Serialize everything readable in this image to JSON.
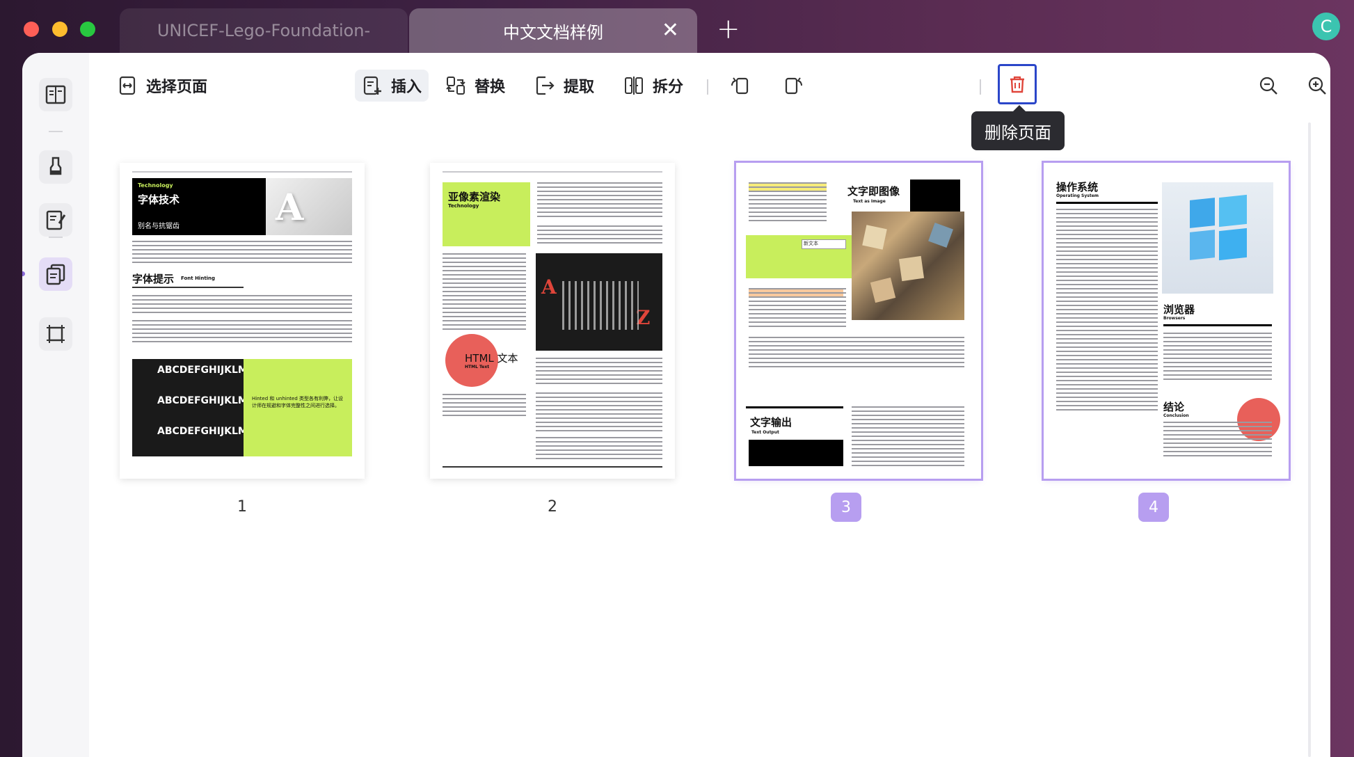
{
  "window": {
    "tabs": [
      {
        "label": "UNICEF-Lego-Foundation-",
        "active": false
      },
      {
        "label": "中文文档样例",
        "active": true
      }
    ],
    "tab_close": "✕",
    "new_tab": "+",
    "avatar_letter": "C"
  },
  "toolbar": {
    "select_pages": "选择页面",
    "insert": "插入",
    "replace": "替换",
    "extract": "提取",
    "split": "拆分",
    "delete_tooltip": "删除页面"
  },
  "pages": [
    {
      "number": "1",
      "title": "字体技术",
      "tag": "Technology",
      "subtitle": "别名与抗锯齿",
      "section": "字体提示",
      "section_en": "Font Hinting",
      "alphabet": "ABCDEFGHIJKLMNC",
      "caption": "Hinted 和 unhinted 类型各有利弊，让设计师在规避和字体完整性之间进行选择。"
    },
    {
      "number": "2",
      "title": "亚像素渲染",
      "tag": "Technology",
      "section": "HTML 文本",
      "section_en": "HTML Text"
    },
    {
      "number": "3",
      "title": "文字即图像",
      "title_en": "Text as Image",
      "section": "文字输出",
      "section_en": "Text Output",
      "field": "新文本"
    },
    {
      "number": "4",
      "title": "操作系统",
      "title_en": "Operating System",
      "section": "浏览器",
      "section_en": "Browsers",
      "conclusion": "结论",
      "conclusion_en": "Conclusion"
    }
  ],
  "colors": {
    "accent": "#b79ef0",
    "lime": "#c8ee5c",
    "delete_red": "#e0453a",
    "focus_blue": "#2b46c9"
  }
}
